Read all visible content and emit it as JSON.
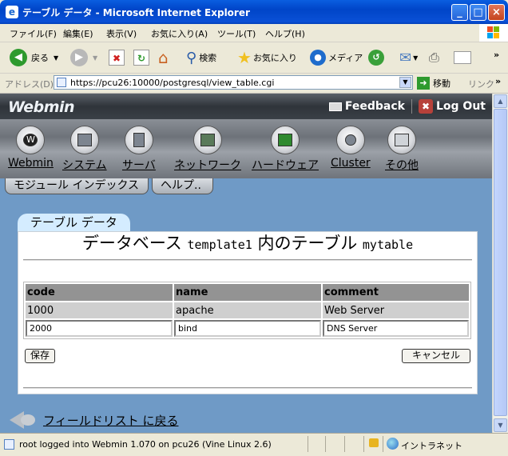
{
  "window": {
    "title": "テーブル データ - Microsoft Internet Explorer",
    "controls": [
      "_",
      "□",
      "×"
    ]
  },
  "menu": [
    "ファイル(F)",
    "編集(E)",
    "表示(V)",
    "お気に入り(A)",
    "ツール(T)",
    "ヘルプ(H)"
  ],
  "toolbar": {
    "back": "戻る",
    "search": "検索",
    "favorites": "お気に入り",
    "media": "メディア"
  },
  "address": {
    "label": "アドレス(D)",
    "url": "https://pcu26:10000/postgresql/view_table.cgi",
    "go": "移動",
    "links": "リンク"
  },
  "webmin": {
    "logo": "Webmin",
    "feedback": "Feedback",
    "logout": "Log Out",
    "nav": [
      {
        "label": "Webmin",
        "icon": "webmin-icon"
      },
      {
        "label": "システム",
        "icon": "system-icon"
      },
      {
        "label": "サーバ",
        "icon": "servers-icon"
      },
      {
        "label": "ネットワーク",
        "icon": "network-icon"
      },
      {
        "label": "ハードウェア",
        "icon": "hardware-icon"
      },
      {
        "label": "Cluster",
        "icon": "cluster-icon"
      },
      {
        "label": "その他",
        "icon": "others-icon"
      }
    ],
    "module_index": "モジュール インデックス",
    "help": "ヘルプ.."
  },
  "content": {
    "tab": "テーブル データ",
    "title_prefix": "データベース",
    "db": "template1",
    "title_mid": "内のテーブル",
    "table": "mytable",
    "columns": [
      "code",
      "name",
      "comment"
    ],
    "rows": [
      [
        "1000",
        "apache",
        "Web Server"
      ]
    ],
    "edit_row": [
      "2000",
      "bind",
      "DNS Server"
    ],
    "save": "保存",
    "cancel": "キャンセル",
    "back_link": "フィールドリスト に戻る"
  },
  "status": {
    "text": "root logged into Webmin 1.070 on pcu26 (Vine Linux 2.6)",
    "zone": "イントラネット"
  }
}
